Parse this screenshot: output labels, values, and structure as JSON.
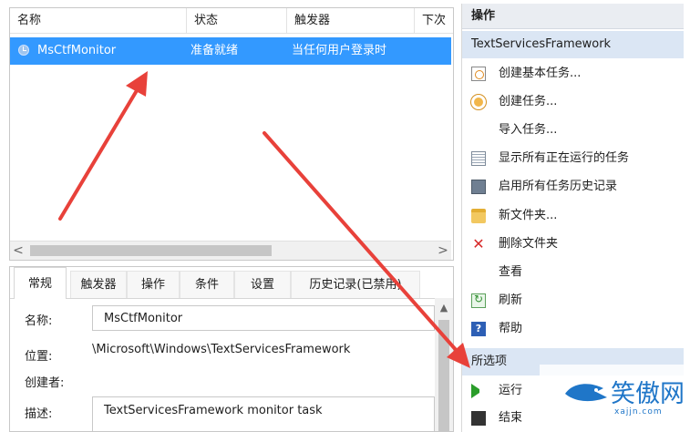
{
  "task_list": {
    "columns": [
      "名称",
      "状态",
      "触发器",
      "下次"
    ],
    "selected_task": {
      "name": "MsCtfMonitor",
      "status": "准备就绪",
      "trigger": "当任何用户登录时"
    },
    "scroll_left": "<",
    "scroll_right": ">"
  },
  "details": {
    "tabs": [
      "常规",
      "触发器",
      "操作",
      "条件",
      "设置",
      "历史记录(已禁用)"
    ],
    "name_label": "名称:",
    "name_value": "MsCtfMonitor",
    "location_label": "位置:",
    "location_value": "\\Microsoft\\Windows\\TextServicesFramework",
    "author_label": "创建者:",
    "description_label": "描述:",
    "description_value": "TextServicesFramework monitor task"
  },
  "actions": {
    "header": "操作",
    "context": "TextServicesFramework",
    "items": [
      "创建基本任务...",
      "创建任务...",
      "导入任务...",
      "显示所有正在运行的任务",
      "启用所有任务历史记录",
      "新文件夹...",
      "删除文件夹",
      "查看",
      "刷新",
      "帮助"
    ],
    "selected_header": "所选项",
    "selected_items": [
      "运行",
      "结束"
    ]
  },
  "watermark": {
    "brand": "笑傲网",
    "domain": "xajjn.com"
  },
  "icons": {
    "task": "clock-icon",
    "play": "play-icon",
    "stop": "stop-icon"
  },
  "colors": {
    "selection": "#3399ff",
    "annotation_arrow": "#e8413a",
    "watermark": "#1f76c8"
  }
}
